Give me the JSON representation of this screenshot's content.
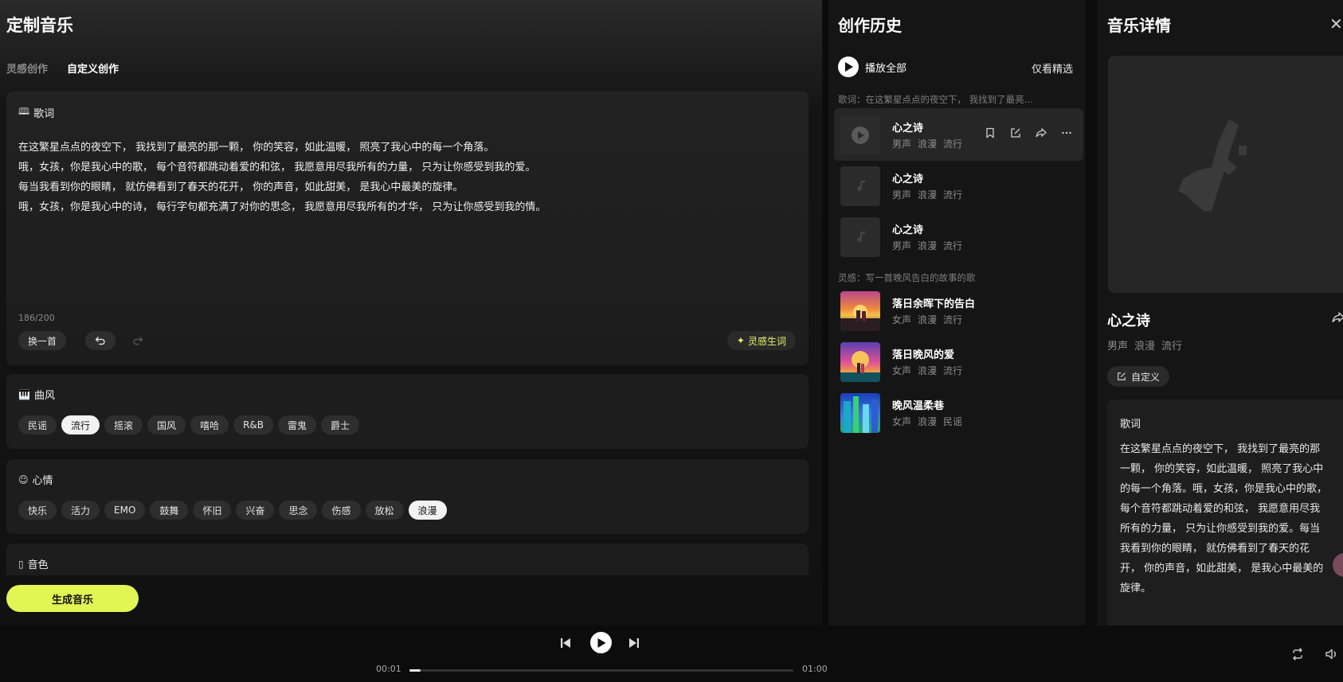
{
  "left": {
    "title": "定制音乐",
    "tabs": [
      {
        "label": "灵感创作",
        "active": false
      },
      {
        "label": "自定义创作",
        "active": true
      }
    ],
    "lyrics": {
      "title": "歌词",
      "lines": [
        "在这繁星点点的夜空下， 我找到了最亮的那一颗， 你的笑容，如此温暖， 照亮了我心中的每一个角落。",
        "哦，女孩，你是我心中的歌， 每个音符都跳动着爱的和弦， 我愿意用尽我所有的力量， 只为让你感受到我的爱。",
        "每当我看到你的眼睛， 就仿佛看到了春天的花开， 你的声音，如此甜美， 是我心中最美的旋律。",
        "哦，女孩，你是我心中的诗， 每行字句都充满了对你的思念， 我愿意用尽我所有的才华， 只为让你感受到我的情。"
      ],
      "count": "186/200",
      "switch_label": "换一首",
      "generate_label": "灵感生词"
    },
    "style": {
      "title": "曲风",
      "options": [
        "民谣",
        "流行",
        "摇滚",
        "国风",
        "嘻哈",
        "R&B",
        "雷鬼",
        "爵士"
      ],
      "selected": "流行"
    },
    "mood": {
      "title": "心情",
      "options": [
        "快乐",
        "活力",
        "EMO",
        "鼓舞",
        "怀旧",
        "兴奋",
        "思念",
        "伤感",
        "放松",
        "浪漫"
      ],
      "selected": "浪漫"
    },
    "timbre": {
      "title": "音色"
    },
    "generate_button": "生成音乐"
  },
  "history": {
    "title": "创作历史",
    "play_all": "播放全部",
    "only_fine": "仅看精选",
    "groups": [
      {
        "label": "歌词：在这繁星点点的夜空下， 我找到了最亮...",
        "songs": [
          {
            "title": "心之诗",
            "tags": [
              "男声",
              "浪漫",
              "流行"
            ],
            "selected": true
          },
          {
            "title": "心之诗",
            "tags": [
              "男声",
              "浪漫",
              "流行"
            ],
            "selected": false
          },
          {
            "title": "心之诗",
            "tags": [
              "男声",
              "浪漫",
              "流行"
            ],
            "selected": false
          }
        ]
      },
      {
        "label": "灵感：写一首晚风告白的故事的歌",
        "songs": [
          {
            "title": "落日余晖下的告白",
            "tags": [
              "女声",
              "浪漫",
              "流行"
            ],
            "selected": false
          },
          {
            "title": "落日晚风的爱",
            "tags": [
              "女声",
              "浪漫",
              "流行"
            ],
            "selected": false
          },
          {
            "title": "晚风温柔巷",
            "tags": [
              "女声",
              "浪漫",
              "民谣"
            ],
            "selected": false
          }
        ]
      }
    ]
  },
  "detail": {
    "title": "音乐详情",
    "song_title": "心之诗",
    "tags": [
      "男声",
      "浪漫",
      "流行"
    ],
    "custom_label": "自定义",
    "lyrics_label": "歌词",
    "lyrics_text": "在这繁星点点的夜空下， 我找到了最亮的那一颗， 你的笑容，如此温暖， 照亮了我心中的每一个角落。哦，女孩，你是我心中的歌， 每个音符都跳动着爱的和弦， 我愿意用尽我所有的力量， 只为让你感受到我的爱。每当我看到你的眼睛， 就仿佛看到了春天的花开， 你的声音，如此甜美， 是我心中最美的旋律。"
  },
  "player": {
    "current": "00:01",
    "total": "01:00",
    "progress": 0.03
  },
  "colors": {
    "accent": "#e3f553",
    "background": "#0c0c0c",
    "panel": "#151515"
  }
}
